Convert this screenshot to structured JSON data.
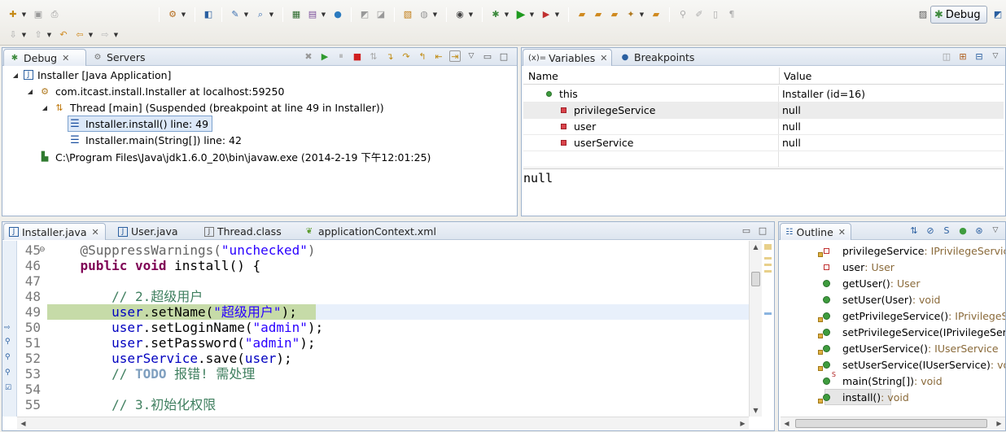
{
  "toolbar": {
    "row1_icons": [
      "new-icon",
      "save-icon",
      "print-icon",
      "new-server-icon",
      "open-type-icon",
      "build-icon",
      "search-icon",
      "new-java-project-icon",
      "globe-icon",
      "open-task-icon",
      "open-resource-icon",
      "capture-icon",
      "debug-icon",
      "run-icon",
      "external-tools-icon",
      "open-perspective-icon"
    ],
    "perspective_label": "Debug"
  },
  "debug_view": {
    "tabs": [
      {
        "label": "Debug"
      },
      {
        "label": "Servers"
      }
    ],
    "tree": [
      {
        "label": "Installer [Java Application]"
      },
      {
        "label": "com.itcast.install.Installer at localhost:59250"
      },
      {
        "label": "Thread [main] (Suspended (breakpoint at line 49 in Installer))"
      },
      {
        "label": "Installer.install() line: 49"
      },
      {
        "label": "Installer.main(String[]) line: 42"
      },
      {
        "label": "C:\\Program Files\\Java\\jdk1.6.0_20\\bin\\javaw.exe (2014-2-19 下午12:01:25)"
      }
    ]
  },
  "variables_view": {
    "tabs": [
      {
        "label": "Variables",
        "prefix": "(x)="
      },
      {
        "label": "Breakpoints"
      }
    ],
    "columns": {
      "name": "Name",
      "value": "Value"
    },
    "rows": [
      {
        "name": "this",
        "value": "Installer  (id=16)"
      },
      {
        "name": "privilegeService",
        "value": "null"
      },
      {
        "name": "user",
        "value": "null"
      },
      {
        "name": "userService",
        "value": "null"
      }
    ],
    "detail": "null"
  },
  "editor": {
    "tabs": [
      {
        "label": "Installer.java"
      },
      {
        "label": "User.java"
      },
      {
        "label": "Thread.class"
      },
      {
        "label": "applicationContext.xml"
      }
    ],
    "lines": [
      {
        "num": "45",
        "parts": [
          {
            "t": "    ",
            "c": ""
          },
          {
            "t": "@SuppressWarnings(",
            "c": "ann"
          },
          {
            "t": "\"unchecked\"",
            "c": "str"
          },
          {
            "t": ")",
            "c": "ann"
          }
        ]
      },
      {
        "num": "46",
        "parts": [
          {
            "t": "    ",
            "c": ""
          },
          {
            "t": "public",
            "c": "kw"
          },
          {
            "t": " ",
            "c": ""
          },
          {
            "t": "void",
            "c": "kw"
          },
          {
            "t": " install() {",
            "c": ""
          }
        ]
      },
      {
        "num": "47",
        "parts": [
          {
            "t": "",
            "c": ""
          }
        ]
      },
      {
        "num": "48",
        "parts": [
          {
            "t": "        ",
            "c": ""
          },
          {
            "t": "// 2.超级用户",
            "c": "cmt"
          }
        ]
      },
      {
        "num": "49",
        "parts": [
          {
            "t": "        ",
            "c": ""
          },
          {
            "t": "user",
            "c": "fld"
          },
          {
            "t": ".setName(",
            "c": ""
          },
          {
            "t": "\"超级用户\"",
            "c": "str"
          },
          {
            "t": ");",
            "c": ""
          }
        ]
      },
      {
        "num": "50",
        "parts": [
          {
            "t": "        ",
            "c": ""
          },
          {
            "t": "user",
            "c": "fld"
          },
          {
            "t": ".setLoginName(",
            "c": ""
          },
          {
            "t": "\"admin\"",
            "c": "str"
          },
          {
            "t": ");",
            "c": ""
          }
        ]
      },
      {
        "num": "51",
        "parts": [
          {
            "t": "        ",
            "c": ""
          },
          {
            "t": "user",
            "c": "fld"
          },
          {
            "t": ".setPassword(",
            "c": ""
          },
          {
            "t": "\"admin\"",
            "c": "str"
          },
          {
            "t": ");",
            "c": ""
          }
        ]
      },
      {
        "num": "52",
        "parts": [
          {
            "t": "        ",
            "c": ""
          },
          {
            "t": "userService",
            "c": "fld"
          },
          {
            "t": ".save(",
            "c": ""
          },
          {
            "t": "user",
            "c": "fld"
          },
          {
            "t": ");",
            "c": ""
          }
        ]
      },
      {
        "num": "53",
        "parts": [
          {
            "t": "        ",
            "c": ""
          },
          {
            "t": "// ",
            "c": "cmt"
          },
          {
            "t": "TODO",
            "c": "todo"
          },
          {
            "t": " 报错! 需处理",
            "c": "cmt"
          }
        ]
      },
      {
        "num": "54",
        "parts": [
          {
            "t": "",
            "c": ""
          }
        ]
      },
      {
        "num": "55",
        "parts": [
          {
            "t": "        ",
            "c": ""
          },
          {
            "t": "// 3.初始化权限",
            "c": "cmt"
          }
        ]
      }
    ],
    "current_line": "49"
  },
  "outline_view": {
    "tab_label": "Outline",
    "items": [
      {
        "name": "privilegeService",
        "type": " : IPrivilegeService"
      },
      {
        "name": "user",
        "type": " : User"
      },
      {
        "name": "getUser()",
        "type": " : User"
      },
      {
        "name": "setUser(User)",
        "type": " : void"
      },
      {
        "name": "getPrivilegeService()",
        "type": " : IPrivilegeSer"
      },
      {
        "name": "setPrivilegeService(IPrivilegeServic",
        "type": ""
      },
      {
        "name": "getUserService()",
        "type": " : IUserService"
      },
      {
        "name": "setUserService(IUserService)",
        "type": " : void"
      },
      {
        "name": "main(String[])",
        "type": " : void"
      },
      {
        "name": "install()",
        "type": " : void"
      }
    ],
    "static_marker": "S"
  }
}
